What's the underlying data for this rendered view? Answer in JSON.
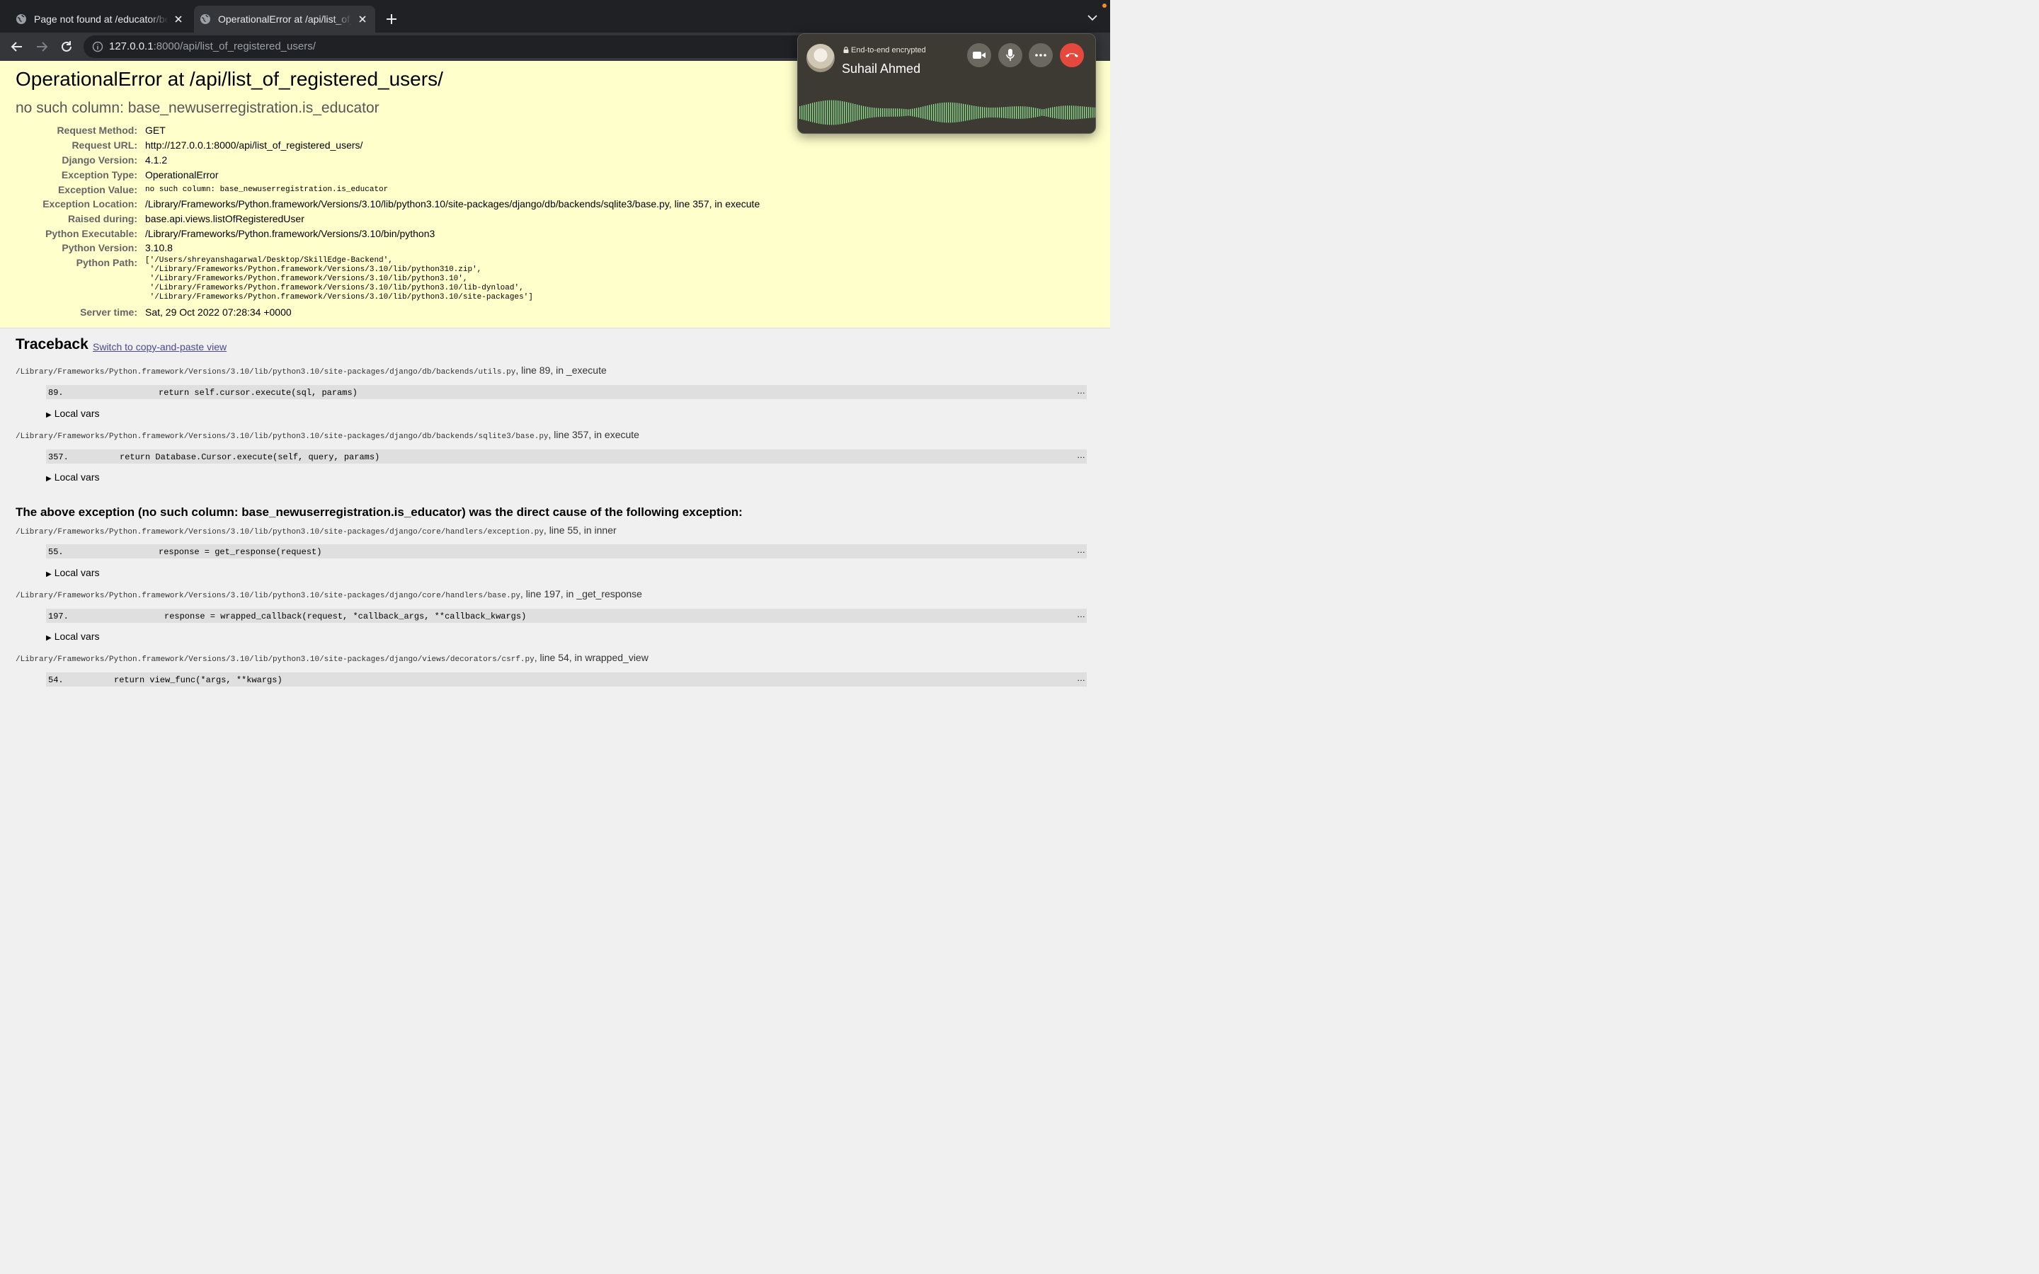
{
  "browser": {
    "tabs": [
      {
        "title": "Page not found at /educator/be",
        "active": false
      },
      {
        "title": "OperationalError at /api/list_of_registered_users/",
        "active": true
      }
    ],
    "url_host": "127.0.0.1",
    "url_rest": ":8000/api/list_of_registered_users/"
  },
  "error": {
    "heading": "OperationalError at /api/list_of_registered_users/",
    "message": "no such column: base_newuserregistration.is_educator",
    "meta": [
      {
        "label": "Request Method:",
        "value": "GET"
      },
      {
        "label": "Request URL:",
        "value": "http://127.0.0.1:8000/api/list_of_registered_users/"
      },
      {
        "label": "Django Version:",
        "value": "4.1.2"
      },
      {
        "label": "Exception Type:",
        "value": "OperationalError"
      },
      {
        "label": "Exception Value:",
        "value": "no such column: base_newuserregistration.is_educator"
      },
      {
        "label": "Exception Location:",
        "value": "/Library/Frameworks/Python.framework/Versions/3.10/lib/python3.10/site-packages/django/db/backends/sqlite3/base.py, line 357, in execute"
      },
      {
        "label": "Raised during:",
        "value": "base.api.views.listOfRegisteredUser"
      },
      {
        "label": "Python Executable:",
        "value": "/Library/Frameworks/Python.framework/Versions/3.10/bin/python3"
      },
      {
        "label": "Python Version:",
        "value": "3.10.8"
      },
      {
        "label": "Python Path:",
        "value": "['/Users/shreyanshagarwal/Desktop/SkillEdge-Backend',\n '/Library/Frameworks/Python.framework/Versions/3.10/lib/python310.zip',\n '/Library/Frameworks/Python.framework/Versions/3.10/lib/python3.10',\n '/Library/Frameworks/Python.framework/Versions/3.10/lib/python3.10/lib-dynload',\n '/Library/Frameworks/Python.framework/Versions/3.10/lib/python3.10/site-packages']"
      },
      {
        "label": "Server time:",
        "value": "Sat, 29 Oct 2022 07:28:34 +0000"
      }
    ]
  },
  "traceback": {
    "heading": "Traceback",
    "switch_link": "Switch to copy-and-paste view",
    "local_vars_label": "Local vars",
    "cause_text": "The above exception (no such column: base_newuserregistration.is_educator) was the direct cause of the following exception:",
    "frames": [
      {
        "file": "/Library/Frameworks/Python.framework/Versions/3.10/lib/python3.10/site-packages/django/db/backends/utils.py",
        "where": ", line 89, in _execute",
        "line_no": "89.",
        "code": "return self.cursor.execute(sql, params)"
      },
      {
        "file": "/Library/Frameworks/Python.framework/Versions/3.10/lib/python3.10/site-packages/django/db/backends/sqlite3/base.py",
        "where": ", line 357, in execute",
        "line_no": "357.",
        "code": "return Database.Cursor.execute(self, query, params)"
      },
      {
        "file": "/Library/Frameworks/Python.framework/Versions/3.10/lib/python3.10/site-packages/django/core/handlers/exception.py",
        "where": ", line 55, in inner",
        "line_no": "55.",
        "code": "response = get_response(request)"
      },
      {
        "file": "/Library/Frameworks/Python.framework/Versions/3.10/lib/python3.10/site-packages/django/core/handlers/base.py",
        "where": ", line 197, in _get_response",
        "line_no": "197.",
        "code": "response = wrapped_callback(request, *callback_args, **callback_kwargs)"
      },
      {
        "file": "/Library/Frameworks/Python.framework/Versions/3.10/lib/python3.10/site-packages/django/views/decorators/csrf.py",
        "where": ", line 54, in wrapped_view",
        "line_no": "54.",
        "code": "return view_func(*args, **kwargs)"
      }
    ],
    "ellipsis": "…"
  },
  "call": {
    "encryption": "End-to-end encrypted",
    "caller": "Suhail Ahmed",
    "end_color": "#e5483c",
    "wave_color": "#8bd98a"
  }
}
